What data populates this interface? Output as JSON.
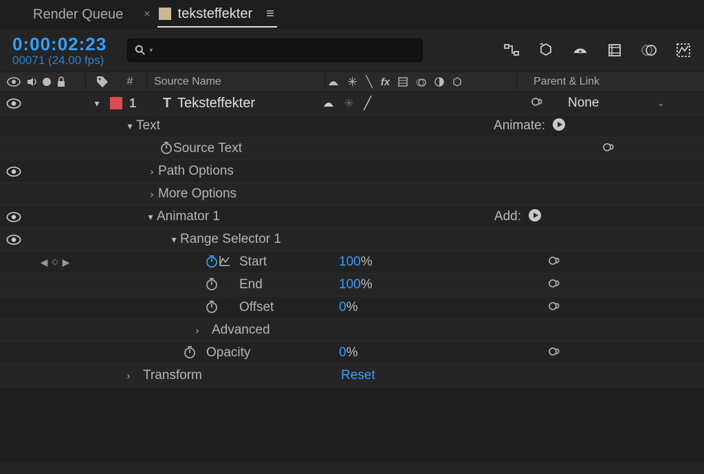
{
  "tabs": {
    "render_queue": "Render Queue",
    "comp_name": "teksteffekter"
  },
  "timecode": {
    "main": "0:00:02:23",
    "sub": "00071 (24.00 fps)"
  },
  "columns": {
    "num": "#",
    "source_name": "Source Name",
    "parent": "Parent & Link"
  },
  "layer": {
    "index": "1",
    "name": "Teksteffekter",
    "parent": "None"
  },
  "groups": {
    "text": "Text",
    "source_text": "Source Text",
    "path_options": "Path Options",
    "more_options": "More Options",
    "animator": "Animator 1",
    "range_selector": "Range Selector 1",
    "advanced": "Advanced",
    "transform": "Transform"
  },
  "animate_label": "Animate:",
  "add_label": "Add:",
  "reset": "Reset",
  "props": {
    "start": {
      "label": "Start",
      "value": "100",
      "unit": "%"
    },
    "end": {
      "label": "End",
      "value": "100",
      "unit": "%"
    },
    "offset": {
      "label": "Offset",
      "value": "0",
      "unit": "%"
    },
    "opacity": {
      "label": "Opacity",
      "value": "0",
      "unit": "%"
    }
  }
}
